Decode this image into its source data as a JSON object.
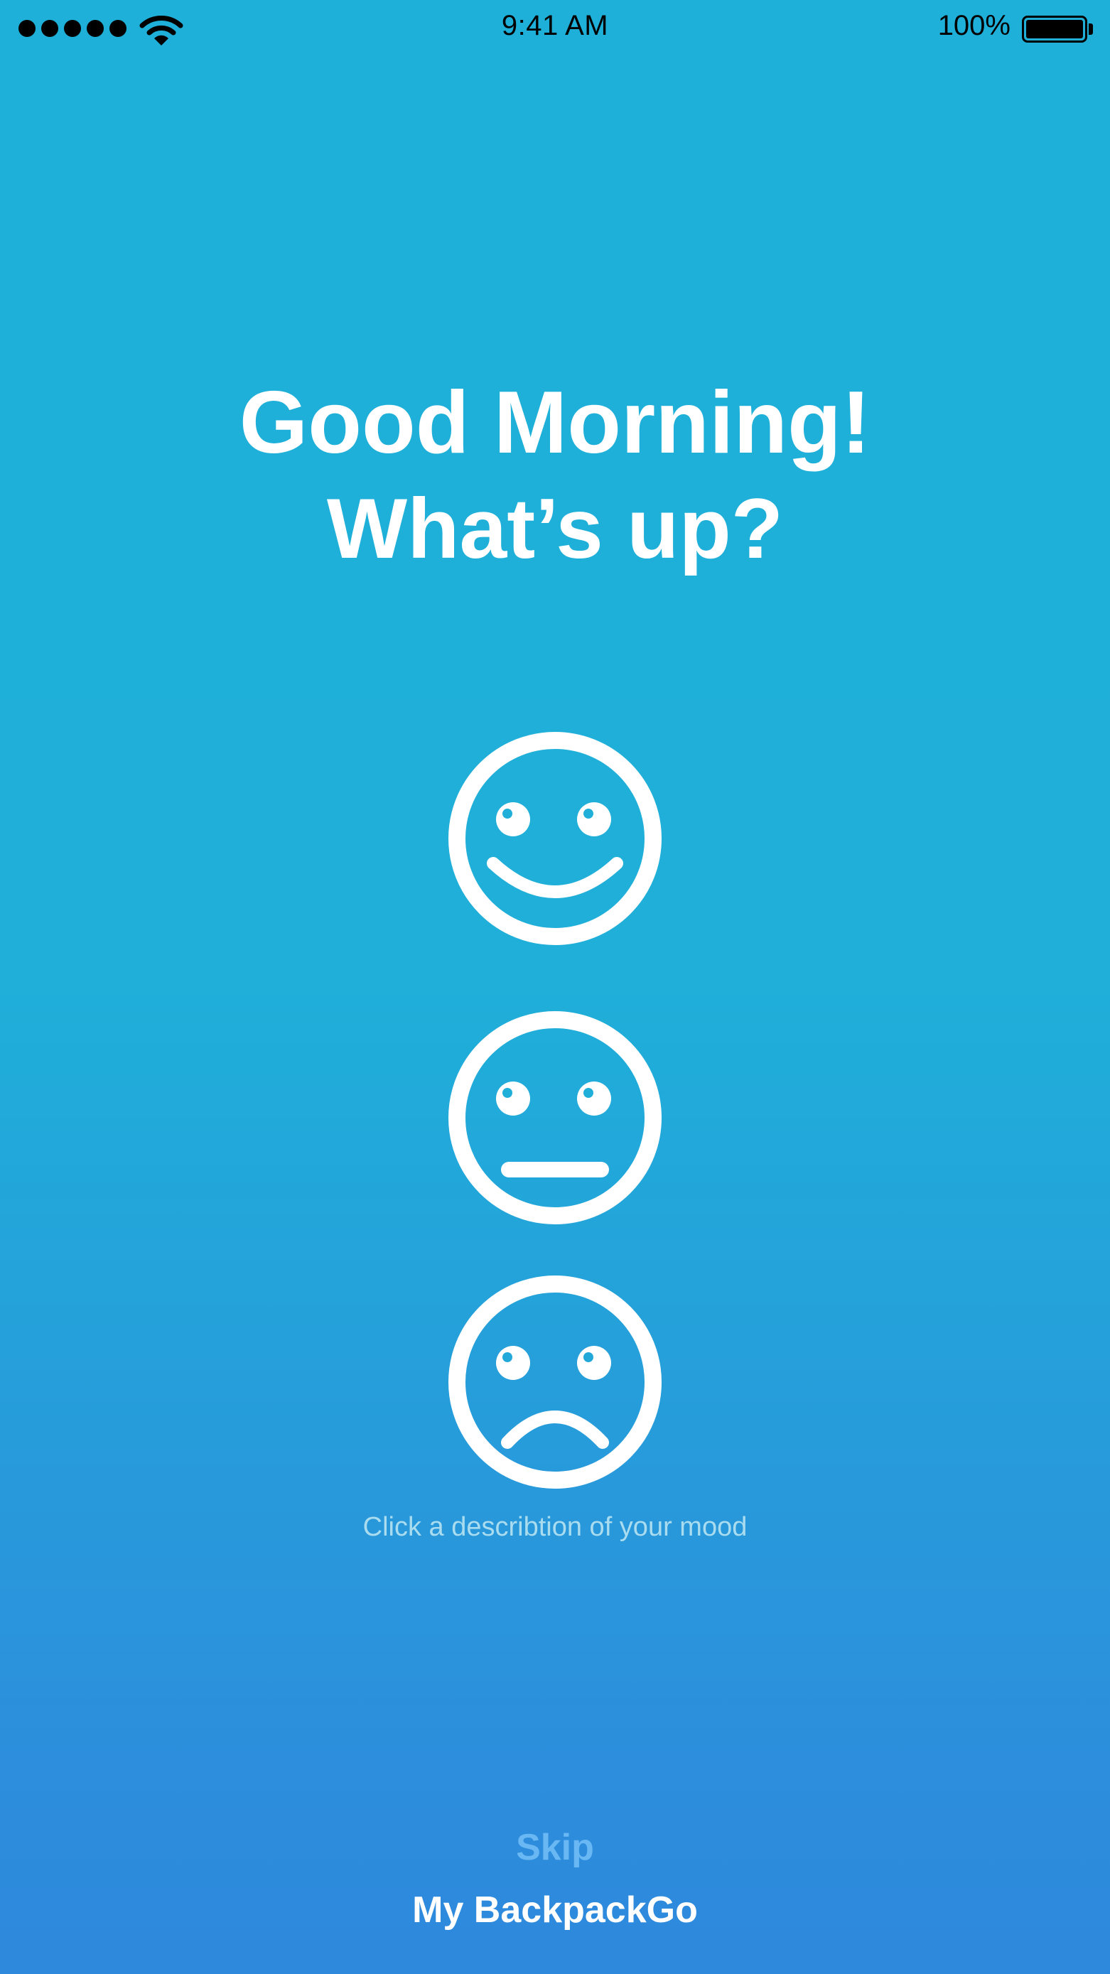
{
  "status_bar": {
    "time": "9:41 AM",
    "battery_percent": "100%",
    "signal_bars": 5,
    "wifi_icon": "wifi-icon",
    "battery_icon": "battery-icon"
  },
  "greeting": {
    "line1": "Good Morning!",
    "line2": "What’s up?"
  },
  "moods": [
    {
      "name": "happy",
      "icon": "happy-face-icon"
    },
    {
      "name": "neutral",
      "icon": "neutral-face-icon"
    },
    {
      "name": "sad",
      "icon": "sad-face-icon"
    }
  ],
  "hint": "Click a describtion of your mood",
  "skip_label": "Skip",
  "brand": "My BackpackGo",
  "colors": {
    "background_top": "#1eb0d9",
    "background_bottom": "#2e88dc",
    "hint": "#a9dcef",
    "skip": "#69b8f4",
    "foreground": "#ffffff"
  }
}
